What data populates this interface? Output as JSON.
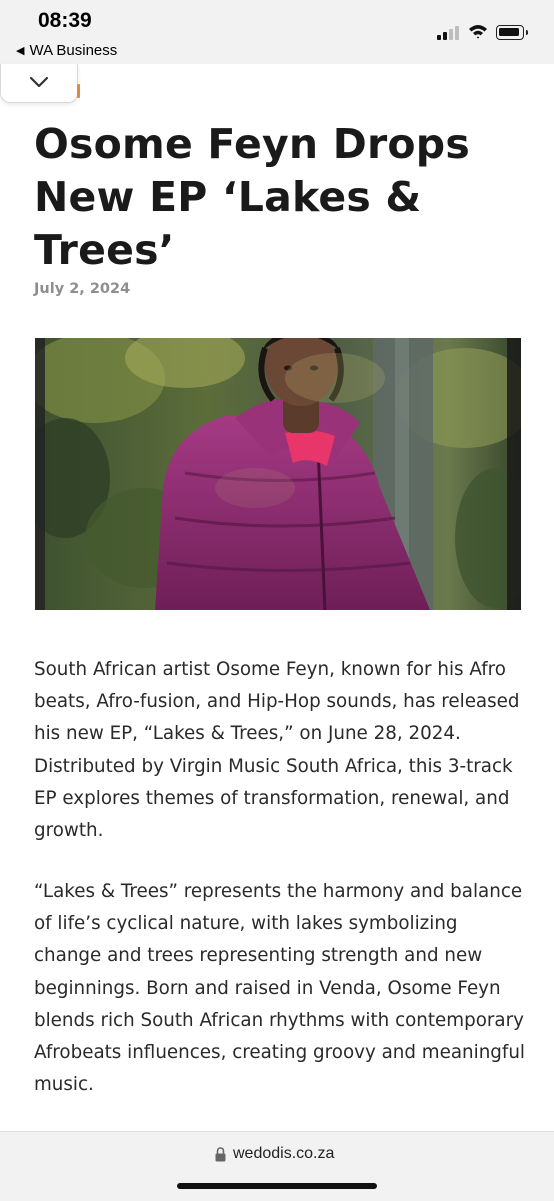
{
  "status_bar": {
    "time": "08:39",
    "back_app": "WA Business",
    "back_icon": "back-triangle-icon",
    "signal_icon": "cellular-signal-icon",
    "wifi_icon": "wifi-icon",
    "battery_icon": "battery-icon"
  },
  "toolbar": {
    "collapse_icon": "chevron-down-icon"
  },
  "article": {
    "title": "Osome Feyn Drops New EP ‘Lakes & Trees’",
    "date": "July 2, 2024",
    "paragraphs": [
      "South African artist Osome Feyn, known for his Afro beats, Afro-fusion, and Hip-Hop sounds, has released his new EP, “Lakes & Trees,” on June 28, 2024. Distributed by Virgin Music South Africa, this 3-track EP explores themes of transformation, renewal, and growth.",
      "“Lakes & Trees” represents the harmony and balance of life’s cyclical nature, with lakes symbolizing change and trees representing strength and new beginnings. Born and raised in Venda, Osome Feyn blends rich South African rhythms with contemporary Afrobeats influences, creating groovy and meaningful music."
    ]
  },
  "browser": {
    "url": "wedodis.co.za",
    "lock_icon": "lock-icon"
  },
  "colors": {
    "title": "#1a1a1a",
    "date": "#8e8e8e",
    "jacket": "#8c2a6e",
    "shirt": "#e8356a",
    "bar_background": "#f2f2f2"
  }
}
